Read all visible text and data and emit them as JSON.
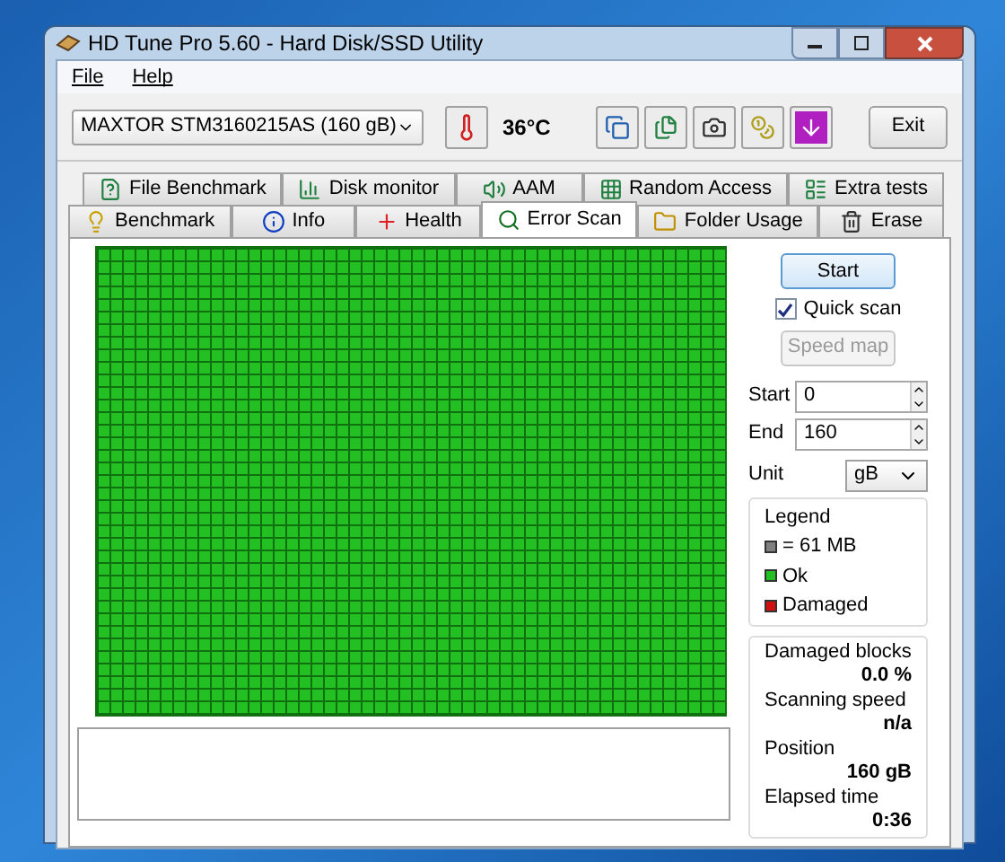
{
  "window": {
    "title": "HD Tune Pro 5.60 - Hard Disk/SSD Utility"
  },
  "menu": [
    "File",
    "Help"
  ],
  "drive": {
    "value": "MAXTOR STM3160215AS (160 gB)"
  },
  "temperature": "36°C",
  "exit_button": "Exit",
  "tabs_back": [
    {
      "label": "File Benchmark",
      "selected": false
    },
    {
      "label": "Disk monitor",
      "selected": false
    },
    {
      "label": "AAM",
      "selected": false
    },
    {
      "label": "Random Access",
      "selected": false
    },
    {
      "label": "Extra tests",
      "selected": false
    }
  ],
  "tabs_front": [
    {
      "label": "Benchmark",
      "selected": false
    },
    {
      "label": "Info",
      "selected": false
    },
    {
      "label": "Health",
      "selected": false
    },
    {
      "label": "Error Scan",
      "selected": true
    },
    {
      "label": "Folder Usage",
      "selected": false
    },
    {
      "label": "Erase",
      "selected": false
    }
  ],
  "scan": {
    "start_button": "Start",
    "quick_scan": {
      "label": "Quick scan",
      "checked": true
    },
    "speed_map": {
      "label": "Speed map",
      "disabled": true
    },
    "start": {
      "label": "Start",
      "value": "0"
    },
    "end": {
      "label": "End",
      "value": "160"
    },
    "unit": {
      "label": "Unit",
      "value": "gB"
    }
  },
  "legend": {
    "title": "Legend",
    "items": [
      {
        "label": "= 61 MB",
        "color": "#808080"
      },
      {
        "label": "Ok",
        "color": "#22c022"
      },
      {
        "label": "Damaged",
        "color": "#d01010"
      }
    ]
  },
  "stats": [
    {
      "label": "Damaged blocks",
      "value": "0.0 %"
    },
    {
      "label": "Scanning speed",
      "value": "n/a"
    },
    {
      "label": "Position",
      "value": "160 gB"
    },
    {
      "label": "Elapsed time",
      "value": "0:36"
    }
  ]
}
